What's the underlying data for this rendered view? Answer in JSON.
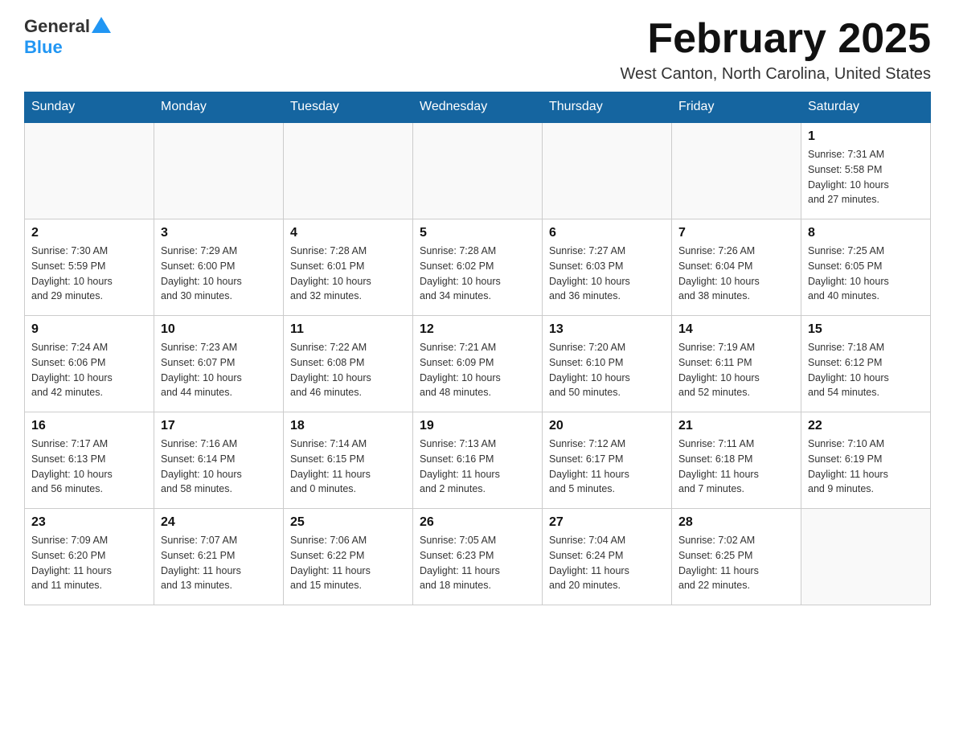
{
  "header": {
    "logo_general": "General",
    "logo_blue": "Blue",
    "month_title": "February 2025",
    "location": "West Canton, North Carolina, United States"
  },
  "days_of_week": [
    "Sunday",
    "Monday",
    "Tuesday",
    "Wednesday",
    "Thursday",
    "Friday",
    "Saturday"
  ],
  "weeks": [
    [
      {
        "day": "",
        "info": ""
      },
      {
        "day": "",
        "info": ""
      },
      {
        "day": "",
        "info": ""
      },
      {
        "day": "",
        "info": ""
      },
      {
        "day": "",
        "info": ""
      },
      {
        "day": "",
        "info": ""
      },
      {
        "day": "1",
        "info": "Sunrise: 7:31 AM\nSunset: 5:58 PM\nDaylight: 10 hours\nand 27 minutes."
      }
    ],
    [
      {
        "day": "2",
        "info": "Sunrise: 7:30 AM\nSunset: 5:59 PM\nDaylight: 10 hours\nand 29 minutes."
      },
      {
        "day": "3",
        "info": "Sunrise: 7:29 AM\nSunset: 6:00 PM\nDaylight: 10 hours\nand 30 minutes."
      },
      {
        "day": "4",
        "info": "Sunrise: 7:28 AM\nSunset: 6:01 PM\nDaylight: 10 hours\nand 32 minutes."
      },
      {
        "day": "5",
        "info": "Sunrise: 7:28 AM\nSunset: 6:02 PM\nDaylight: 10 hours\nand 34 minutes."
      },
      {
        "day": "6",
        "info": "Sunrise: 7:27 AM\nSunset: 6:03 PM\nDaylight: 10 hours\nand 36 minutes."
      },
      {
        "day": "7",
        "info": "Sunrise: 7:26 AM\nSunset: 6:04 PM\nDaylight: 10 hours\nand 38 minutes."
      },
      {
        "day": "8",
        "info": "Sunrise: 7:25 AM\nSunset: 6:05 PM\nDaylight: 10 hours\nand 40 minutes."
      }
    ],
    [
      {
        "day": "9",
        "info": "Sunrise: 7:24 AM\nSunset: 6:06 PM\nDaylight: 10 hours\nand 42 minutes."
      },
      {
        "day": "10",
        "info": "Sunrise: 7:23 AM\nSunset: 6:07 PM\nDaylight: 10 hours\nand 44 minutes."
      },
      {
        "day": "11",
        "info": "Sunrise: 7:22 AM\nSunset: 6:08 PM\nDaylight: 10 hours\nand 46 minutes."
      },
      {
        "day": "12",
        "info": "Sunrise: 7:21 AM\nSunset: 6:09 PM\nDaylight: 10 hours\nand 48 minutes."
      },
      {
        "day": "13",
        "info": "Sunrise: 7:20 AM\nSunset: 6:10 PM\nDaylight: 10 hours\nand 50 minutes."
      },
      {
        "day": "14",
        "info": "Sunrise: 7:19 AM\nSunset: 6:11 PM\nDaylight: 10 hours\nand 52 minutes."
      },
      {
        "day": "15",
        "info": "Sunrise: 7:18 AM\nSunset: 6:12 PM\nDaylight: 10 hours\nand 54 minutes."
      }
    ],
    [
      {
        "day": "16",
        "info": "Sunrise: 7:17 AM\nSunset: 6:13 PM\nDaylight: 10 hours\nand 56 minutes."
      },
      {
        "day": "17",
        "info": "Sunrise: 7:16 AM\nSunset: 6:14 PM\nDaylight: 10 hours\nand 58 minutes."
      },
      {
        "day": "18",
        "info": "Sunrise: 7:14 AM\nSunset: 6:15 PM\nDaylight: 11 hours\nand 0 minutes."
      },
      {
        "day": "19",
        "info": "Sunrise: 7:13 AM\nSunset: 6:16 PM\nDaylight: 11 hours\nand 2 minutes."
      },
      {
        "day": "20",
        "info": "Sunrise: 7:12 AM\nSunset: 6:17 PM\nDaylight: 11 hours\nand 5 minutes."
      },
      {
        "day": "21",
        "info": "Sunrise: 7:11 AM\nSunset: 6:18 PM\nDaylight: 11 hours\nand 7 minutes."
      },
      {
        "day": "22",
        "info": "Sunrise: 7:10 AM\nSunset: 6:19 PM\nDaylight: 11 hours\nand 9 minutes."
      }
    ],
    [
      {
        "day": "23",
        "info": "Sunrise: 7:09 AM\nSunset: 6:20 PM\nDaylight: 11 hours\nand 11 minutes."
      },
      {
        "day": "24",
        "info": "Sunrise: 7:07 AM\nSunset: 6:21 PM\nDaylight: 11 hours\nand 13 minutes."
      },
      {
        "day": "25",
        "info": "Sunrise: 7:06 AM\nSunset: 6:22 PM\nDaylight: 11 hours\nand 15 minutes."
      },
      {
        "day": "26",
        "info": "Sunrise: 7:05 AM\nSunset: 6:23 PM\nDaylight: 11 hours\nand 18 minutes."
      },
      {
        "day": "27",
        "info": "Sunrise: 7:04 AM\nSunset: 6:24 PM\nDaylight: 11 hours\nand 20 minutes."
      },
      {
        "day": "28",
        "info": "Sunrise: 7:02 AM\nSunset: 6:25 PM\nDaylight: 11 hours\nand 22 minutes."
      },
      {
        "day": "",
        "info": ""
      }
    ]
  ]
}
